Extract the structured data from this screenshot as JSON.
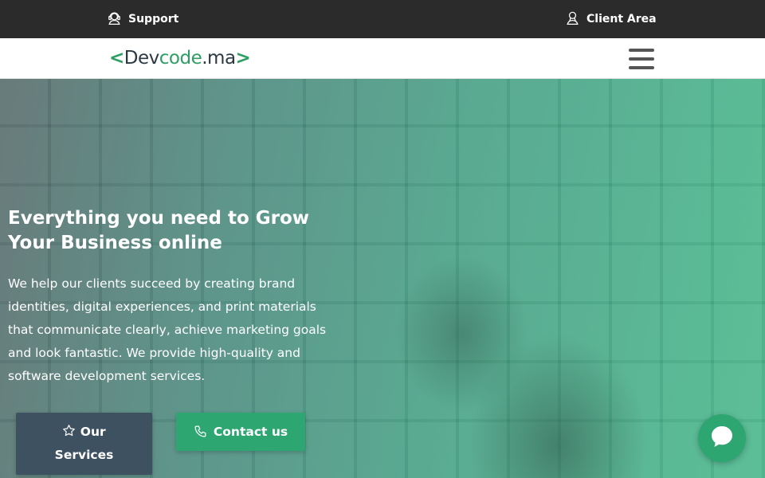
{
  "topbar": {
    "support_label": "Support",
    "client_area_label": "Client Area"
  },
  "logo": {
    "open_bracket": "<",
    "dev": "Dev",
    "code": "code",
    "tld": ".ma",
    "close_bracket": ">"
  },
  "hero": {
    "title": "Everything you need to Grow Your Business online",
    "description": "We help our clients succeed by creating brand identities, digital experiences, and print materials that communicate clearly, achieve marketing goals and look fantastic. We provide high-quality and software development services.",
    "services_button": "Our Services",
    "contact_button": "Contact us"
  },
  "colors": {
    "topbar_bg": "#2b2b2b",
    "brand_green": "#2ea672",
    "services_button_bg": "#3e5160"
  },
  "icons": {
    "support": "headset-icon",
    "client_area": "user-icon",
    "services": "star-icon",
    "contact": "phone-icon",
    "chat": "chat-bubble-icon"
  }
}
